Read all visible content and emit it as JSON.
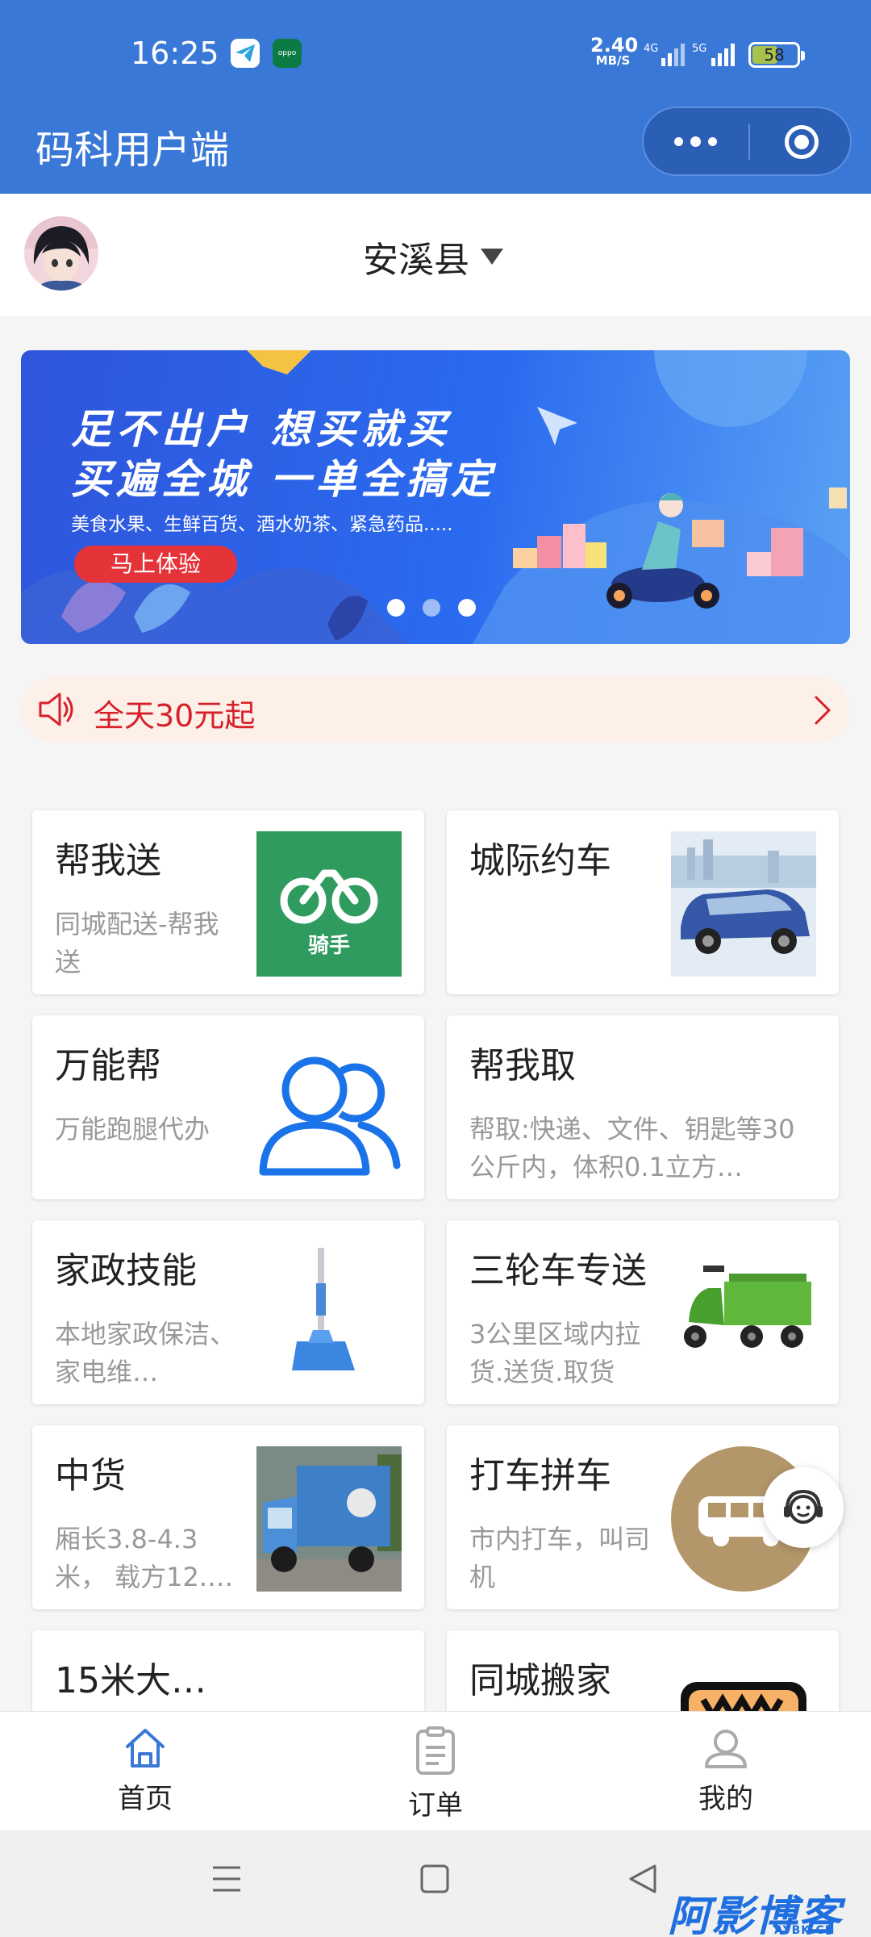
{
  "status_bar": {
    "time": "16:25",
    "oppo_label": "oppo",
    "net_speed": "2.40",
    "net_unit": "MB/S",
    "sim1_label": "4G",
    "sim2_label": "5G",
    "battery": "58",
    "battery_level": 0.58
  },
  "title_bar": {
    "title": "码科用户端",
    "more_icon": "more-dots-icon",
    "close_icon": "mini-program-close-icon"
  },
  "location": {
    "name": "安溪县"
  },
  "banner": {
    "headline_1": "足不出户 想买就买",
    "headline_2": "买遍全城 一单全搞定",
    "subline": "美食水果、生鲜百货、酒水奶茶、紧急药品.....",
    "button": "马上体验",
    "slides_total": 3,
    "active_slide": 3
  },
  "notice": {
    "text": "全天30元起",
    "icon": "speaker-icon"
  },
  "services": [
    {
      "title": "帮我送",
      "desc": "同城配送-帮我送",
      "thumb": "rider-logo",
      "thumb_text": "骑手"
    },
    {
      "title": "城际约车",
      "desc": "",
      "thumb": "minivan-photo"
    },
    {
      "title": "万能帮",
      "desc": "万能跑腿代办",
      "thumb": "users-icon"
    },
    {
      "title": "帮我取",
      "desc": "帮取:快递、文件、钥匙等30公斤内，体积0.1立方…",
      "thumb": ""
    },
    {
      "title": "家政技能",
      "desc": "本地家政保洁、家电维…",
      "thumb": "mop-photo"
    },
    {
      "title": "三轮车专送",
      "desc": "3公里区域内拉货.送货.取货",
      "thumb": "tricycle-photo"
    },
    {
      "title": "中货",
      "desc": "厢长3.8-4.3米， 载方12.…",
      "thumb": "truck-photo"
    },
    {
      "title": "打车拼车",
      "desc": "市内打车，叫司机",
      "thumb": "bus-icon"
    },
    {
      "title": "15米大…",
      "desc": "",
      "thumb": "container-photo"
    },
    {
      "title": "同城搬家",
      "desc": "",
      "thumb": "moving-icon"
    }
  ],
  "tabbar": {
    "home": "首页",
    "orders": "订单",
    "mine": "我的",
    "active": "home"
  },
  "watermark": {
    "text": "阿影博客",
    "sub": "AYBK.CN"
  }
}
